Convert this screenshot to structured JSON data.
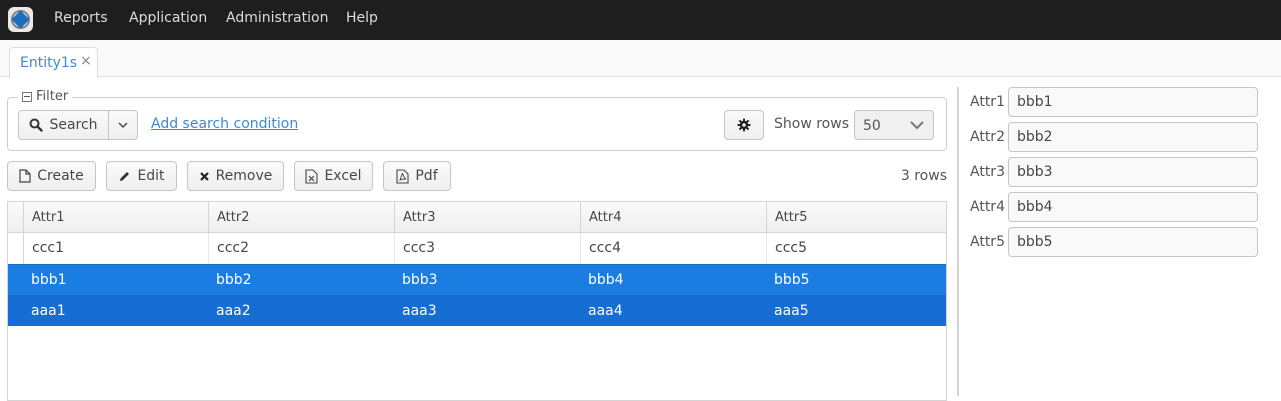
{
  "menu": {
    "logo_icon": "app-logo",
    "items": [
      "Reports",
      "Application",
      "Administration",
      "Help"
    ]
  },
  "tabs": [
    {
      "label": "Entity1s",
      "close": "×"
    }
  ],
  "filter": {
    "legend": "Filter",
    "search_label": "Search",
    "add_condition": "Add search condition",
    "show_rows_label": "Show rows",
    "show_rows_value": "50"
  },
  "actions": {
    "create": "Create",
    "edit": "Edit",
    "remove": "Remove",
    "excel": "Excel",
    "pdf": "Pdf",
    "row_count": "3 rows"
  },
  "table": {
    "columns": [
      "Attr1",
      "Attr2",
      "Attr3",
      "Attr4",
      "Attr5"
    ],
    "rows": [
      {
        "cells": [
          "ccc1",
          "ccc2",
          "ccc3",
          "ccc4",
          "ccc5"
        ],
        "selected": false
      },
      {
        "cells": [
          "bbb1",
          "bbb2",
          "bbb3",
          "bbb4",
          "bbb5"
        ],
        "selected": true
      },
      {
        "cells": [
          "aaa1",
          "aaa2",
          "aaa3",
          "aaa4",
          "aaa5"
        ],
        "selected": true
      }
    ],
    "selection_color": "#197de1"
  },
  "form": {
    "fields": [
      {
        "label": "Attr1",
        "value": "bbb1"
      },
      {
        "label": "Attr2",
        "value": "bbb2"
      },
      {
        "label": "Attr3",
        "value": "bbb3"
      },
      {
        "label": "Attr4",
        "value": "bbb4"
      },
      {
        "label": "Attr5",
        "value": "bbb5"
      }
    ]
  },
  "colors": {
    "topbar": "#1e1e1e",
    "link": "#3b8ad9",
    "accent": "#197de1"
  }
}
